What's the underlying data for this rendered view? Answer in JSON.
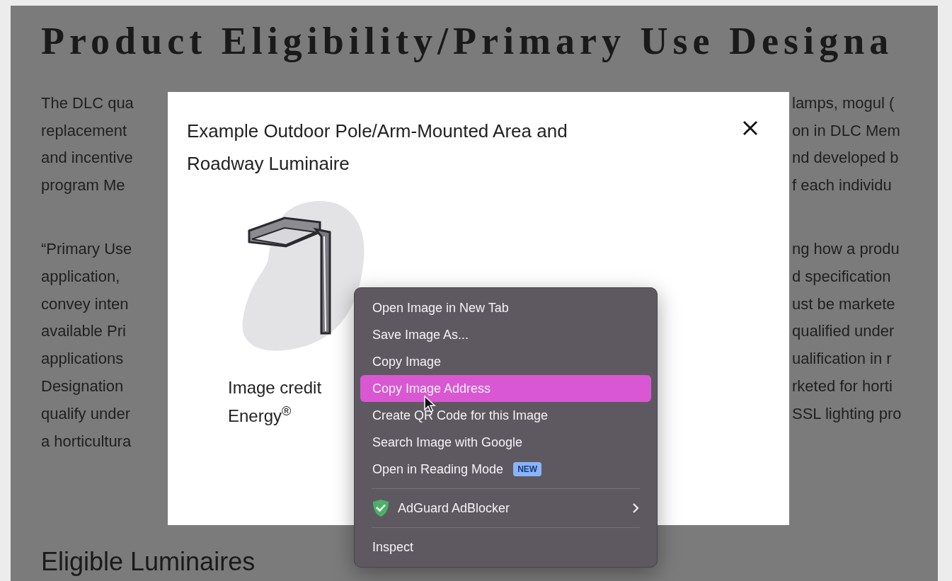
{
  "page": {
    "heading": "Product Eligibility/Primary Use Designa",
    "paragraphs": [
      [
        {
          "left": "The DLC qua",
          "right": "lamps, mogul ("
        },
        {
          "left": "replacement",
          "right": "on in DLC Mem"
        },
        {
          "left": "and incentive",
          "right": "nd developed b"
        },
        {
          "left": "program Me",
          "right": "f each individu"
        }
      ],
      [
        {
          "left": "“Primary Use",
          "right": "ng how a produ"
        },
        {
          "left": "application,",
          "right": "d specification"
        },
        {
          "left": "convey inten",
          "right": "ust be markete"
        },
        {
          "left": "available Pri",
          "right": "qualified under"
        },
        {
          "left": "applications",
          "right": "ualification in r"
        },
        {
          "left": "Designation",
          "right": "rketed for horti"
        },
        {
          "left": "qualify under",
          "right": "SSL lighting pro"
        },
        {
          "left": "a horticultura"
        }
      ]
    ],
    "subheading": "Eligible Luminaires"
  },
  "modal": {
    "title": "Example Outdoor Pole/Arm-Mounted Area and Roadway Luminaire",
    "caption": [
      "Image credit",
      "Energy$^{®}$"
    ]
  },
  "context_menu": {
    "items": [
      {
        "kind": "item",
        "label": "Open Image in New Tab",
        "selected": false
      },
      {
        "kind": "item",
        "label": "Save Image As...",
        "selected": false
      },
      {
        "kind": "item",
        "label": "Copy Image",
        "selected": false
      },
      {
        "kind": "item",
        "label": "Copy Image Address",
        "selected": true
      },
      {
        "kind": "item",
        "label": "Create QR Code for this Image",
        "selected": false
      },
      {
        "kind": "item",
        "label": "Search Image with Google",
        "selected": false
      },
      {
        "kind": "item",
        "label": "Open in Reading Mode",
        "badge": "NEW",
        "selected": false
      },
      {
        "kind": "separator"
      },
      {
        "kind": "submenu",
        "label": "AdGuard AdBlocker",
        "selected": false
      },
      {
        "kind": "separator"
      },
      {
        "kind": "item",
        "label": "Inspect",
        "selected": false
      }
    ]
  }
}
